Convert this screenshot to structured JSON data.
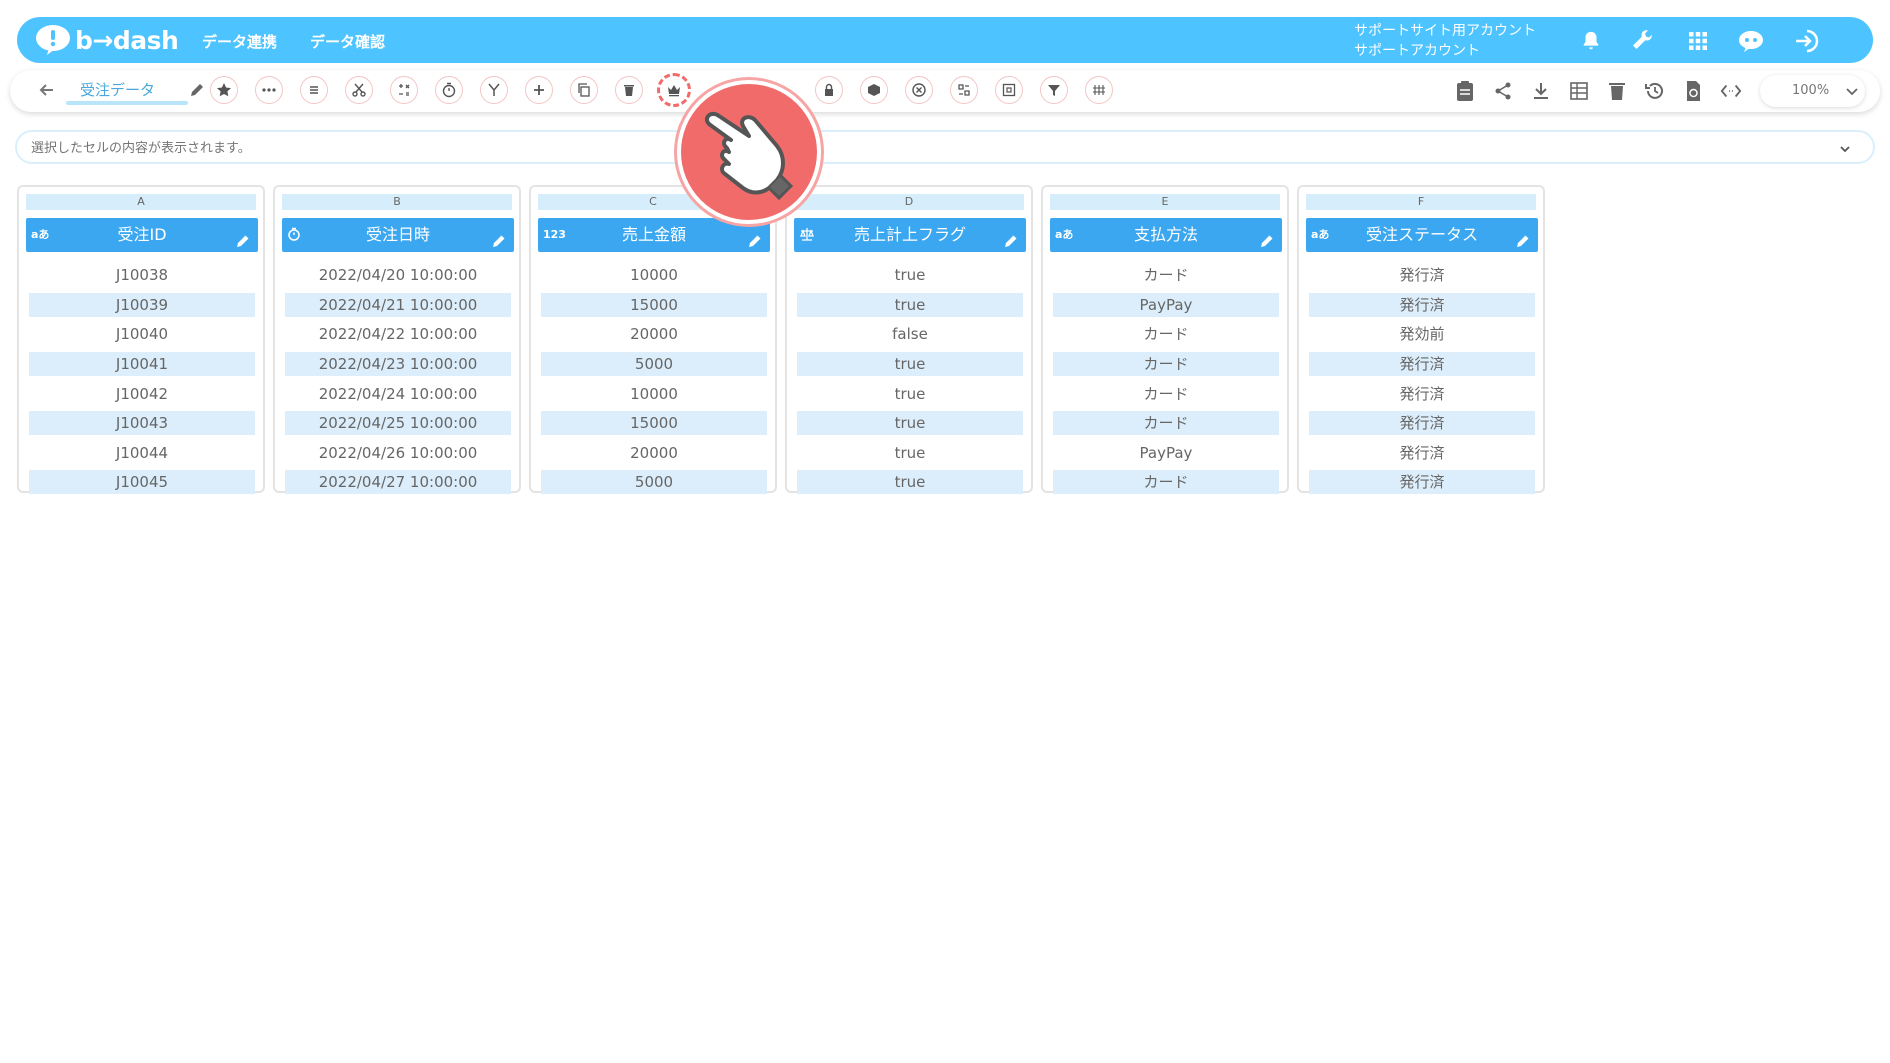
{
  "header": {
    "logo_text": "b→dash",
    "nav": [
      "データ連携",
      "データ確認"
    ],
    "account_line1": "サポートサイト用アカウント",
    "account_line2": "サポートアカウント",
    "icons": [
      "bell-icon",
      "wrench-icon",
      "apps-grid-icon",
      "support-bot-icon",
      "logout-icon"
    ]
  },
  "toolbar": {
    "title": "受注データ",
    "tools": [
      "star-icon",
      "more-icon",
      "list-icon",
      "scissors-icon",
      "calc-icon",
      "timer-icon",
      "merge-icon",
      "add-icon",
      "copy-icon",
      "trash-icon",
      "crown-icon",
      "lock-icon",
      "box-icon",
      "close-circle-icon",
      "replace-icon",
      "frame-icon",
      "filter-icon",
      "grid-icon"
    ],
    "right_icons": [
      "clipboard-icon",
      "share-icon",
      "download-icon",
      "table-icon",
      "delete-icon",
      "history-icon",
      "refresh-icon",
      "code-icon"
    ],
    "zoom": "100%"
  },
  "cellbar": {
    "placeholder": "選択したセルの内容が表示されます。"
  },
  "grid": {
    "columns": [
      {
        "letter": "A",
        "type": "aあ",
        "name": "受注ID"
      },
      {
        "letter": "B",
        "type": "clock",
        "name": "受注日時"
      },
      {
        "letter": "C",
        "type": "123",
        "name": "売上金額"
      },
      {
        "letter": "D",
        "type": "scale",
        "name": "売上計上フラグ"
      },
      {
        "letter": "E",
        "type": "aあ",
        "name": "支払方法"
      },
      {
        "letter": "F",
        "type": "aあ",
        "name": "受注ステータス"
      }
    ],
    "rows": [
      [
        "J10038",
        "2022/04/20 10:00:00",
        "10000",
        "true",
        "カード",
        "発行済"
      ],
      [
        "J10039",
        "2022/04/21 10:00:00",
        "15000",
        "true",
        "PayPay",
        "発行済"
      ],
      [
        "J10040",
        "2022/04/22 10:00:00",
        "20000",
        "false",
        "カード",
        "発効前"
      ],
      [
        "J10041",
        "2022/04/23 10:00:00",
        "5000",
        "true",
        "カード",
        "発行済"
      ],
      [
        "J10042",
        "2022/04/24 10:00:00",
        "10000",
        "true",
        "カード",
        "発行済"
      ],
      [
        "J10043",
        "2022/04/25 10:00:00",
        "15000",
        "true",
        "カード",
        "発行済"
      ],
      [
        "J10044",
        "2022/04/26 10:00:00",
        "20000",
        "true",
        "PayPay",
        "発行済"
      ],
      [
        "J10045",
        "2022/04/27 10:00:00",
        "5000",
        "true",
        "カード",
        "発行済"
      ]
    ]
  },
  "colors": {
    "header_bg": "#4dc4ff",
    "column_header": "#3ba7f0",
    "row_alt": "#dceefb",
    "highlight": "#f26b6b"
  }
}
